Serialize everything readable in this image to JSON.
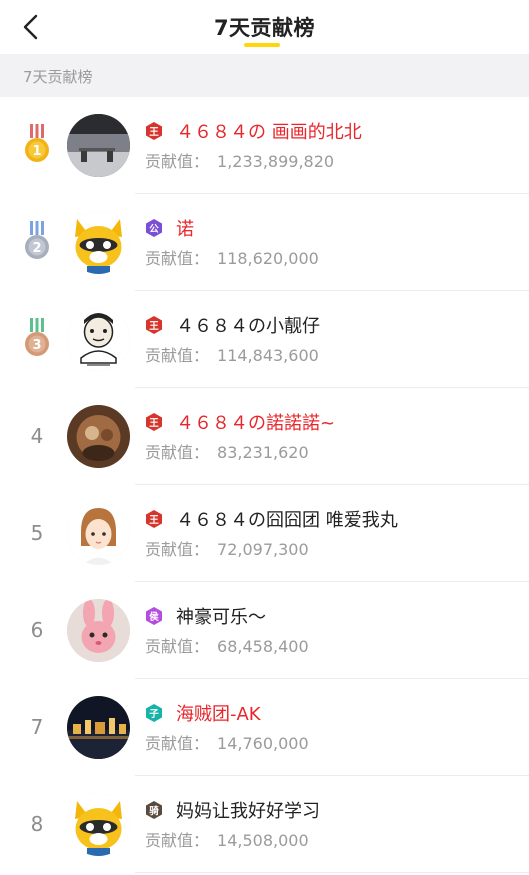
{
  "header": {
    "title": "7天贡献榜"
  },
  "section": {
    "label": "7天贡献榜"
  },
  "contrib_label": "贡献值：",
  "rows": [
    {
      "rank": "1",
      "badge": "王",
      "name": "４６８４の 画画的北北",
      "value": "1,233,899,820",
      "name_color": "red"
    },
    {
      "rank": "2",
      "badge": "公",
      "name": "诺",
      "value": "118,620,000",
      "name_color": "red"
    },
    {
      "rank": "3",
      "badge": "王",
      "name": "４６８４の小靓仔",
      "value": "114,843,600",
      "name_color": "dark"
    },
    {
      "rank": "4",
      "badge": "王",
      "name": "４６８４の諾諾諾~",
      "value": "83,231,620",
      "name_color": "red"
    },
    {
      "rank": "5",
      "badge": "王",
      "name": "４６８４の囧囧团 唯爱我丸",
      "value": "72,097,300",
      "name_color": "dark"
    },
    {
      "rank": "6",
      "badge": "侯",
      "name": "神豪可乐～",
      "value": "68,458,400",
      "name_color": "dark"
    },
    {
      "rank": "7",
      "badge": "子",
      "name": "海贼团-AK",
      "value": "14,760,000",
      "name_color": "red"
    },
    {
      "rank": "8",
      "badge": "骑",
      "name": "妈妈让我好好学习",
      "value": "14,508,000",
      "name_color": "dark"
    }
  ],
  "colors": {
    "accent": "#ffd60a",
    "name_red": "#e8262b",
    "gold": "#f2b318",
    "silver": "#a9aebd",
    "bronze": "#d29a76",
    "badge_king": "#d6352d",
    "badge_duke": "#7a4fd6",
    "badge_marquis": "#b44ce0",
    "badge_viscount": "#18b3a8",
    "badge_knight": "#5a4a3e"
  },
  "icons": {
    "back": "chevron-left-icon",
    "medals": [
      "gold-medal-icon",
      "silver-medal-icon",
      "bronze-medal-icon"
    ],
    "badges": [
      "king-badge-icon",
      "duke-badge-icon",
      "marquis-badge-icon",
      "viscount-badge-icon",
      "knight-badge-icon"
    ]
  }
}
